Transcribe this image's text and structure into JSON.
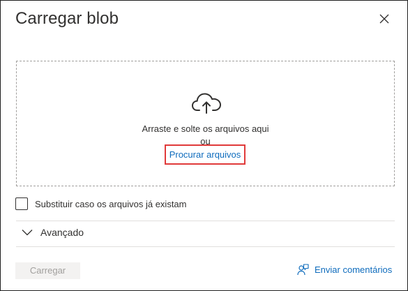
{
  "dialog": {
    "title": "Carregar blob",
    "close_icon": "close-icon"
  },
  "dropzone": {
    "icon": "cloud-upload-icon",
    "line1": "Arraste e solte os arquivos aqui",
    "line2": "ou",
    "browse_link": "Procurar arquivos"
  },
  "overwrite": {
    "label": "Substituir caso os arquivos já existam",
    "checked": false
  },
  "advanced": {
    "label": "Avançado",
    "icon": "chevron-down-icon"
  },
  "footer": {
    "upload_label": "Carregar",
    "feedback_label": "Enviar comentários",
    "feedback_icon": "feedback-icon"
  },
  "colors": {
    "link": "#0f6cbd",
    "highlight_border": "#e03a3a",
    "disabled_bg": "#f3f2f1",
    "disabled_text": "#a19f9d"
  }
}
